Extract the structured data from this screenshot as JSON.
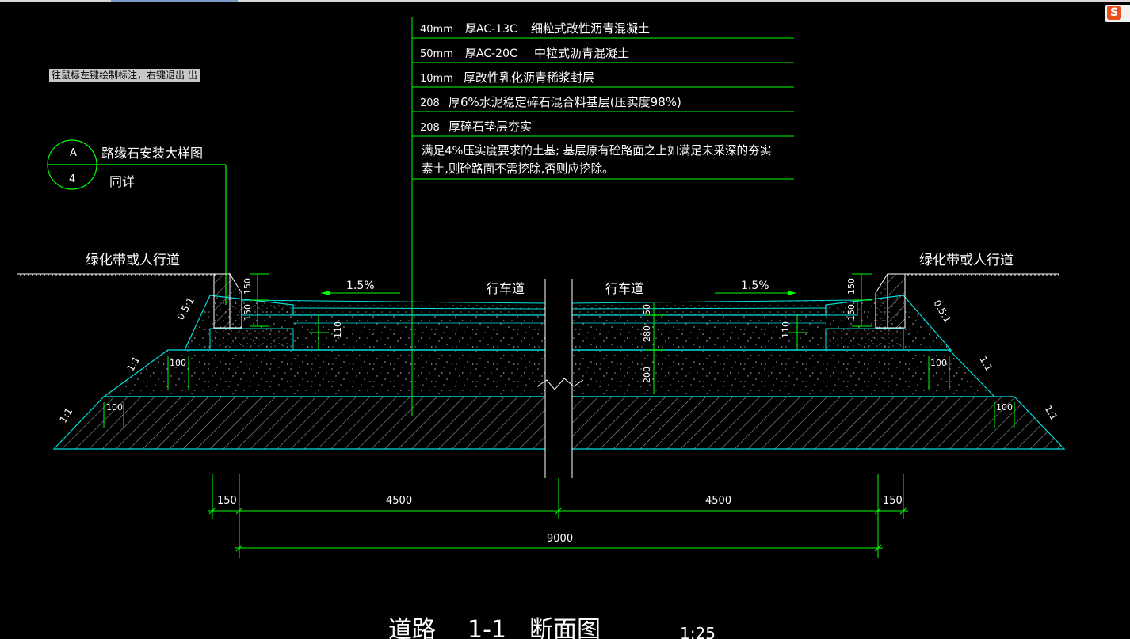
{
  "window": {
    "tooltip": "往鼠标左键绘制标注，右键退出 出"
  },
  "ime": {
    "logo": "S"
  },
  "colors": {
    "background": "#000000",
    "line": "#00ff00",
    "outline": "#00e0e0",
    "text": "#ffffff",
    "hatch": "#ffffff"
  },
  "layers": [
    {
      "thickness": "40mm",
      "material": "厚AC-13C",
      "desc": "细粒式改性沥青混凝土"
    },
    {
      "thickness": "50mm",
      "material": "厚AC-20C",
      "desc": "中粒式沥青混凝土"
    },
    {
      "thickness": "10mm",
      "material": "",
      "desc": "厚改性乳化沥青稀浆封层"
    },
    {
      "thickness": "208",
      "material": "",
      "desc": "厚6%水泥稳定碎石混合料基层(压实度98%)"
    },
    {
      "thickness": "208",
      "material": "",
      "desc": "厚碎石垫层夯实"
    }
  ],
  "note": {
    "line1": "满足4%压实度要求的土基; 基层原有砼路面之上如满足未采深的夯实",
    "line2": "素土,则砼路面不需挖除,否则应挖除。"
  },
  "detail": {
    "circle_top": "A",
    "circle_bottom": "4",
    "title": "路缘石安装大样图",
    "sub": "同详"
  },
  "side_labels": {
    "left": "绿化带或人行道",
    "right": "绿化带或人行道"
  },
  "lane_labels": {
    "left": "行车道",
    "right": "行车道"
  },
  "slopes": {
    "left": "1.5%",
    "right": "1.5%",
    "batter_left": "0.5:1",
    "batter_right": "0.5:1",
    "fill_left": "1:1",
    "fill_right": "1:1",
    "base_left": "1:1",
    "base_right": "1:1"
  },
  "dims": {
    "curb_h1": "150",
    "curb_h2": "150",
    "curb_h3": "150",
    "curb_h4": "150",
    "l110": "110",
    "r110": "110",
    "r50": "50",
    "r280": "280",
    "r200": "200",
    "s100a": "100",
    "s100b": "100",
    "s100c": "100",
    "s100d": "100",
    "w150l": "150",
    "w4500l": "4500",
    "w4500r": "4500",
    "w150r": "150",
    "total": "9000"
  },
  "title": {
    "name": "道路",
    "number": "1-1",
    "suffix": "断面图",
    "scale": "1:25"
  }
}
